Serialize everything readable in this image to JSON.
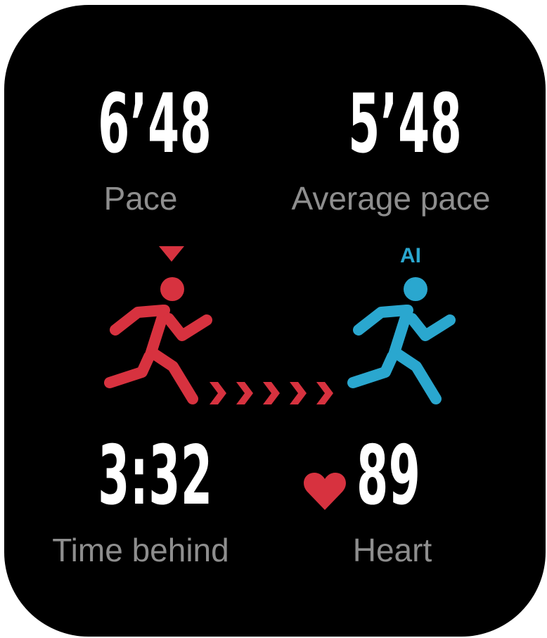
{
  "colors": {
    "background": "#000000",
    "value_text": "#ffffff",
    "label_text": "#8e8e8e",
    "user_runner": "#d7323f",
    "ai_runner": "#2aa7cf",
    "heart": "#d7323f"
  },
  "metrics": {
    "pace": {
      "value": "6’48",
      "label": "Pace"
    },
    "average_pace": {
      "value": "5’48",
      "label": "Average pace"
    },
    "time_behind": {
      "value": "3:32",
      "label": "Time behind"
    },
    "heart": {
      "value": "89",
      "label": "Heart"
    }
  },
  "race": {
    "ai_badge": "AI",
    "user_marker_icon": "triangle-down-icon",
    "user_icon": "runner-icon",
    "ai_icon": "runner-icon",
    "progress_icon": "chevron-right-icon",
    "progress_chevron_count": 5
  },
  "heart_icon": "heart-icon"
}
